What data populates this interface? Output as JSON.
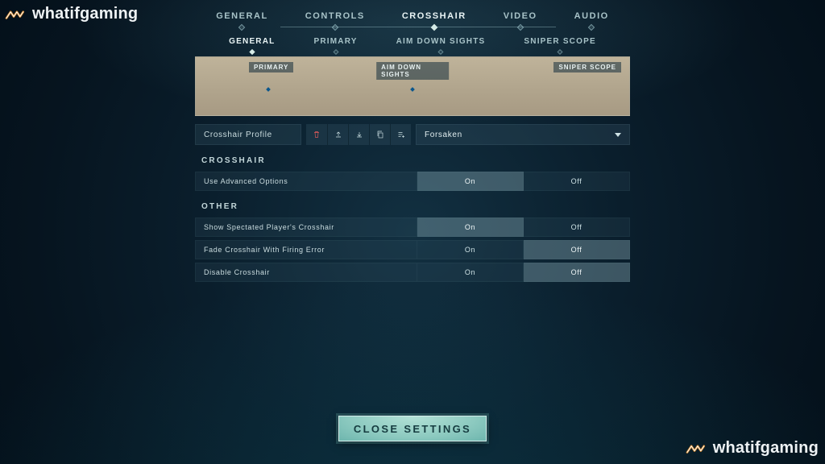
{
  "brand": {
    "name": "whatifgaming"
  },
  "topnav": {
    "items": [
      "GENERAL",
      "CONTROLS",
      "CROSSHAIR",
      "VIDEO",
      "AUDIO"
    ],
    "active_index": 2
  },
  "subnav": {
    "items": [
      "GENERAL",
      "PRIMARY",
      "AIM DOWN SIGHTS",
      "SNIPER SCOPE"
    ],
    "active_index": 0
  },
  "preview": {
    "tags": [
      "PRIMARY",
      "AIM DOWN SIGHTS",
      "SNIPER SCOPE"
    ]
  },
  "profile": {
    "label": "Crosshair Profile",
    "selected": "Forsaken",
    "icons": [
      "delete",
      "export",
      "import",
      "copy",
      "create"
    ]
  },
  "sections": {
    "crosshair": {
      "title": "CROSSHAIR",
      "rows": [
        {
          "label": "Use Advanced Options",
          "options": [
            "On",
            "Off"
          ],
          "selected": 0
        }
      ]
    },
    "other": {
      "title": "OTHER",
      "rows": [
        {
          "label": "Show Spectated Player's Crosshair",
          "options": [
            "On",
            "Off"
          ],
          "selected": 0
        },
        {
          "label": "Fade Crosshair With Firing Error",
          "options": [
            "On",
            "Off"
          ],
          "selected": 1
        },
        {
          "label": "Disable Crosshair",
          "options": [
            "On",
            "Off"
          ],
          "selected": 1
        }
      ]
    }
  },
  "close_label": "CLOSE SETTINGS"
}
